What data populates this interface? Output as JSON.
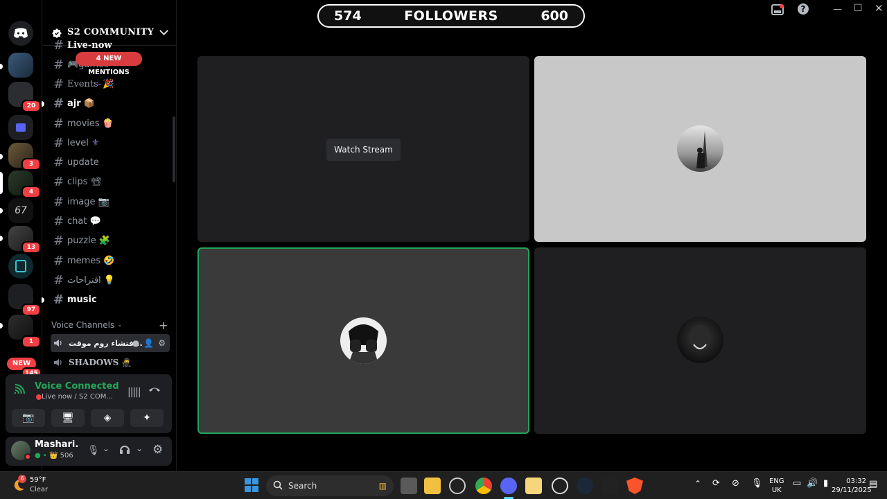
{
  "server": {
    "name": "S2 COMMUNITY"
  },
  "rail": {
    "badges": [
      "20",
      "3",
      "4",
      "13",
      "97",
      "1",
      "145"
    ],
    "new_label": "NEW"
  },
  "mentions_label": "4 NEW MENTIONS",
  "channels": [
    {
      "name": "Live-now",
      "emoji": ""
    },
    {
      "name": "games",
      "emoji": "🎮"
    },
    {
      "name": "Events-",
      "emoji": "🎉"
    },
    {
      "name": "ajr",
      "emoji": "📦"
    },
    {
      "name": "movies",
      "emoji": "🍿"
    },
    {
      "name": "level",
      "emoji": "⚜"
    },
    {
      "name": "update",
      "emoji": ""
    },
    {
      "name": "clips",
      "emoji": "📽"
    },
    {
      "name": "image",
      "emoji": "📷"
    },
    {
      "name": "chat",
      "emoji": "💬"
    },
    {
      "name": "puzzle",
      "emoji": "🧩"
    },
    {
      "name": "memes",
      "emoji": "🤣"
    },
    {
      "name": "اقتراحات",
      "emoji": "💡"
    },
    {
      "name": "music",
      "emoji": ""
    }
  ],
  "voice_section": {
    "title": "Voice Channels"
  },
  "voice_channels": [
    {
      "name": "فتشاء روم موقت..."
    },
    {
      "name": "SHADOWS",
      "emoji": "🥷"
    }
  ],
  "voice_panel": {
    "title": "Voice Connected",
    "subtitle": "Live now / S2 COM..."
  },
  "user": {
    "name": "Mashari.",
    "status": "506"
  },
  "stream": {
    "watch_label": "Watch Stream"
  },
  "followers": {
    "left": "574",
    "label": "FOLLOWERS",
    "right": "600"
  },
  "taskbar": {
    "temp": "59°F",
    "weather": "Clear",
    "weather_badge": "6",
    "search": "Search",
    "lang1": "ENG",
    "lang2": "UK",
    "time": "03:32",
    "date": "29/11/2025"
  },
  "colors": {
    "accent_green": "#23a55a",
    "mention_red": "#f23f43",
    "blurple": "#5865f2"
  }
}
